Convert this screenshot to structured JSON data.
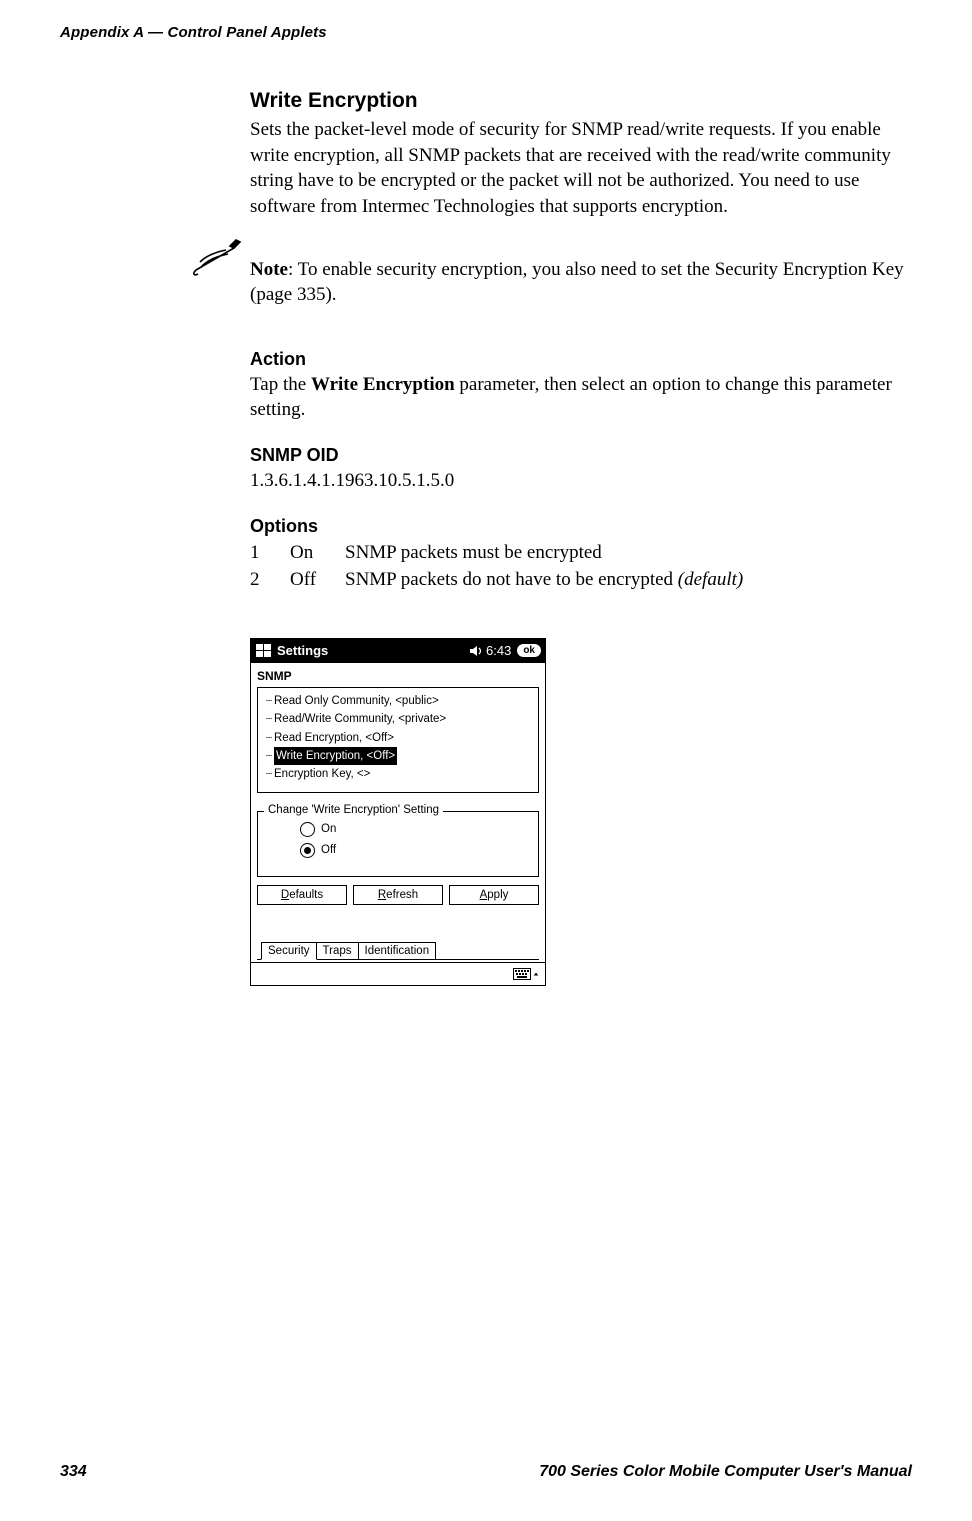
{
  "header": {
    "left": "Appendix  A    —   Control Panel Applets"
  },
  "section": {
    "title": "Write Encryption",
    "intro": "Sets the packet-level mode of security for SNMP read/write requests. If you enable write encryption, all SNMP packets that are received with the read/write community string have to be encrypted or the packet will not be authorized. You need to use software from Intermec Technologies that supports encryption."
  },
  "note": {
    "label": "Note",
    "text": ": To enable security encryption, you also need to set the Security Encryption Key (page 335)."
  },
  "action": {
    "title": "Action",
    "pre": "Tap the ",
    "bold": "Write Encryption",
    "post": " parameter, then select an option to change this parameter setting."
  },
  "oid": {
    "title": "SNMP OID",
    "value": "1.3.6.1.4.1.1963.10.5.1.5.0"
  },
  "options": {
    "title": "Options",
    "rows": [
      {
        "num": "1",
        "name": "On",
        "desc": "SNMP packets must be encrypted"
      },
      {
        "num": "2",
        "name": "Off",
        "desc_pre": "SNMP packets do not have to be encrypted ",
        "desc_italic": "(default)"
      }
    ]
  },
  "device": {
    "titlebar": {
      "title": "Settings",
      "clock": "6:43",
      "ok": "ok"
    },
    "group": "SNMP",
    "tree": [
      "Read Only Community, <public>",
      "Read/Write Community, <private>",
      "Read Encryption, <Off>",
      "Write Encryption, <Off>",
      "Encryption Key, <>"
    ],
    "tree_selected_index": 3,
    "change_legend": "Change 'Write Encryption' Setting",
    "radio": {
      "on": "On",
      "off": "Off",
      "selected": "off"
    },
    "buttons": {
      "defaults": "Defaults",
      "refresh": "Refresh",
      "apply": "Apply",
      "defaults_u": "D",
      "refresh_u": "R",
      "apply_u": "A"
    },
    "tabs": [
      "Security",
      "Traps",
      "Identification"
    ],
    "active_tab_index": 0
  },
  "footer": {
    "page": "334",
    "right": "700 Series Color Mobile Computer User's Manual"
  }
}
